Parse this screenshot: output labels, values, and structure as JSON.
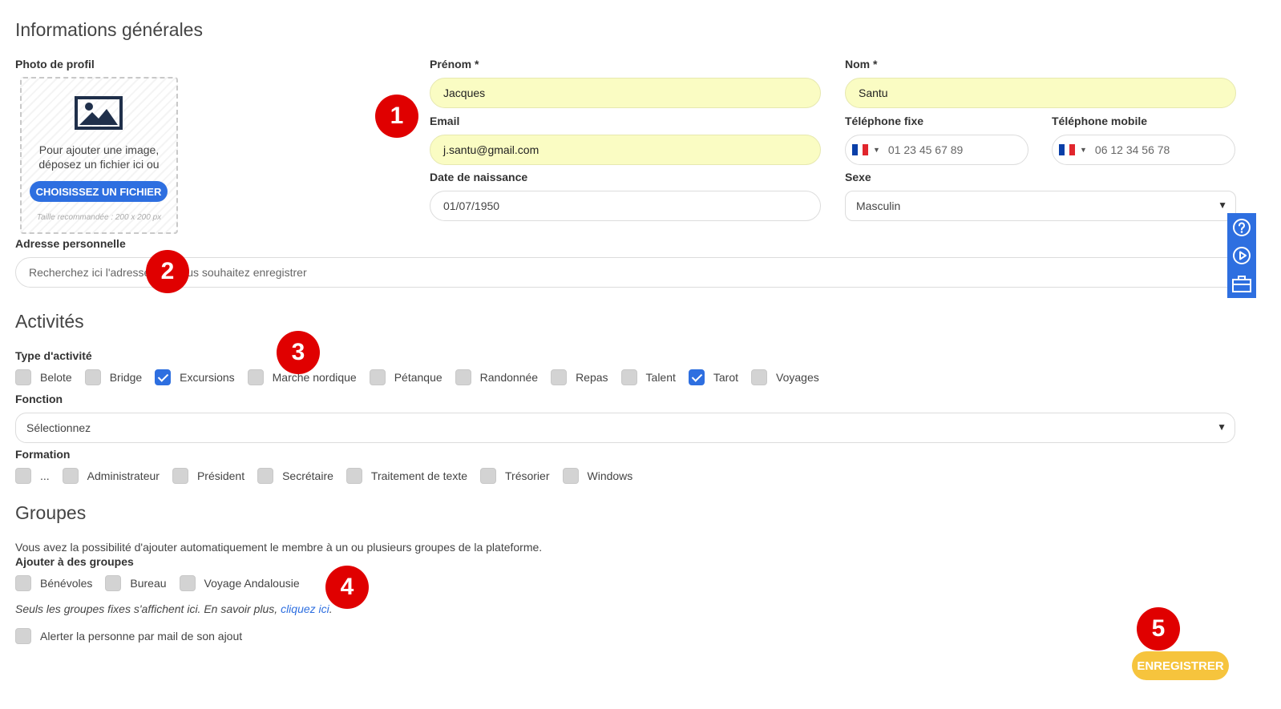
{
  "general": {
    "title": "Informations générales",
    "photo_label": "Photo de profil",
    "upload_text": "Pour ajouter une image, déposez un fichier ici ou",
    "upload_button": "CHOISISSEZ UN FICHIER",
    "upload_hint": "Taille recommandée : 200 x 200 px",
    "first_name_label": "Prénom *",
    "first_name_value": "Jacques",
    "last_name_label": "Nom *",
    "last_name_value": "Santu",
    "email_label": "Email",
    "email_value": "j.santu@gmail.com",
    "phone_fixed_label": "Téléphone fixe",
    "phone_fixed_value": "01 23 45 67 89",
    "phone_mobile_label": "Téléphone mobile",
    "phone_mobile_value": "06 12 34 56 78",
    "birthdate_label": "Date de naissance",
    "birthdate_value": "01/07/1950",
    "sex_label": "Sexe",
    "sex_value": "Masculin",
    "address_label": "Adresse personnelle",
    "address_placeholder": "Recherchez ici l'adresse que vous souhaitez enregistrer"
  },
  "activities": {
    "title": "Activités",
    "type_label": "Type d'activité",
    "types": [
      {
        "label": "Belote",
        "checked": false
      },
      {
        "label": "Bridge",
        "checked": false
      },
      {
        "label": "Excursions",
        "checked": true
      },
      {
        "label": "Marche nordique",
        "checked": false
      },
      {
        "label": "Pétanque",
        "checked": false
      },
      {
        "label": "Randonnée",
        "checked": false
      },
      {
        "label": "Repas",
        "checked": false
      },
      {
        "label": "Talent",
        "checked": false
      },
      {
        "label": "Tarot",
        "checked": true
      },
      {
        "label": "Voyages",
        "checked": false
      }
    ],
    "function_label": "Fonction",
    "function_value": "Sélectionnez",
    "training_label": "Formation",
    "trainings": [
      {
        "label": "...",
        "checked": false
      },
      {
        "label": "Administrateur",
        "checked": false
      },
      {
        "label": "Président",
        "checked": false
      },
      {
        "label": "Secrétaire",
        "checked": false
      },
      {
        "label": "Traitement de texte",
        "checked": false
      },
      {
        "label": "Trésorier",
        "checked": false
      },
      {
        "label": "Windows",
        "checked": false
      }
    ]
  },
  "groups": {
    "title": "Groupes",
    "description": "Vous avez la possibilité d'ajouter automatiquement le membre à un ou plusieurs groupes de la plateforme.",
    "add_label": "Ajouter à des groupes",
    "items": [
      {
        "label": "Bénévoles",
        "checked": false
      },
      {
        "label": "Bureau",
        "checked": false
      },
      {
        "label": "Voyage Andalousie",
        "checked": false
      }
    ],
    "note_text": "Seuls les groupes fixes s'affichent ici. En savoir plus, ",
    "note_link": "cliquez ici",
    "note_end": ".",
    "alert_label": "Alerter la personne par mail de son ajout"
  },
  "save_button": "ENREGISTRER",
  "badges": [
    "1",
    "2",
    "3",
    "4",
    "5"
  ],
  "colors": {
    "accent": "#2e6fe0",
    "highlight_field": "#fafcc3",
    "save": "#f6c43d",
    "badge": "#e00000"
  },
  "flag_colors": [
    "#0a3fa8",
    "#ffffff",
    "#e1262d"
  ],
  "icons": {
    "image": "image-placeholder-icon",
    "help": "help-circle-icon",
    "play": "play-circle-icon",
    "toolbox": "toolbox-icon",
    "caret": "chevron-down-icon"
  }
}
